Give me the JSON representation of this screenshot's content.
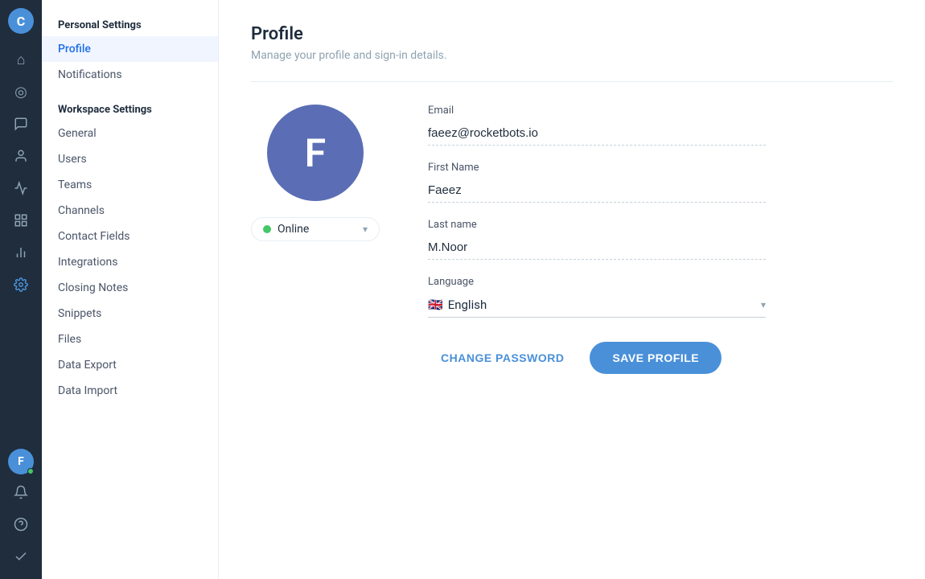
{
  "app": {
    "logo_letter": "C",
    "title": "Personal Settings"
  },
  "icon_nav": [
    {
      "name": "home-icon",
      "symbol": "⌂"
    },
    {
      "name": "chart-icon",
      "symbol": "◎"
    },
    {
      "name": "chat-icon",
      "symbol": "▭"
    },
    {
      "name": "contacts-icon",
      "symbol": "👤"
    },
    {
      "name": "stats-icon",
      "symbol": "📊"
    },
    {
      "name": "org-icon",
      "symbol": "⊞"
    },
    {
      "name": "reports-icon",
      "symbol": "▦"
    },
    {
      "name": "settings-icon",
      "symbol": "⚙"
    }
  ],
  "bottom_icons": [
    {
      "name": "bell-icon",
      "symbol": "🔔"
    },
    {
      "name": "help-icon",
      "symbol": "?"
    },
    {
      "name": "check-icon",
      "symbol": "✓"
    }
  ],
  "user": {
    "avatar_letter": "F",
    "email": "faeez@rocketbots.io",
    "first_name": "Faeez",
    "last_name": "M.Noor",
    "language": "English",
    "language_flag": "🇬🇧",
    "status": "Online"
  },
  "personal_settings": {
    "section_label": "Personal Settings",
    "items": [
      {
        "label": "Profile",
        "active": true
      },
      {
        "label": "Notifications",
        "active": false
      }
    ]
  },
  "workspace_settings": {
    "section_label": "Workspace Settings",
    "items": [
      {
        "label": "General",
        "active": false
      },
      {
        "label": "Users",
        "active": false
      },
      {
        "label": "Teams",
        "active": false
      },
      {
        "label": "Channels",
        "active": false
      },
      {
        "label": "Contact Fields",
        "active": false
      },
      {
        "label": "Integrations",
        "active": false
      },
      {
        "label": "Closing Notes",
        "active": false
      },
      {
        "label": "Snippets",
        "active": false
      },
      {
        "label": "Files",
        "active": false
      },
      {
        "label": "Data Export",
        "active": false
      },
      {
        "label": "Data Import",
        "active": false
      }
    ]
  },
  "page": {
    "title": "Profile",
    "subtitle": "Manage your profile and sign-in details."
  },
  "form": {
    "email_label": "Email",
    "email_value": "faeez@rocketbots.io",
    "first_name_label": "First Name",
    "first_name_value": "Faeez",
    "last_name_label": "Last name",
    "last_name_value": "M.Noor",
    "language_label": "Language",
    "language_value": "English",
    "language_flag": "🇬🇧"
  },
  "buttons": {
    "change_password": "CHANGE PASSWORD",
    "save_profile": "SAVE PROFILE"
  },
  "colors": {
    "accent": "#4a90d9",
    "online": "#44c767",
    "avatar_bg": "#5b6eb5"
  }
}
